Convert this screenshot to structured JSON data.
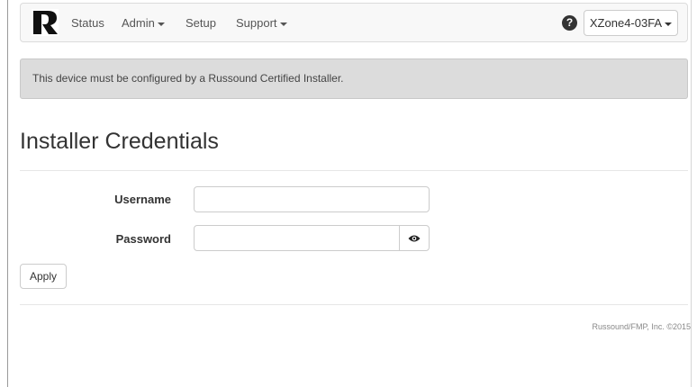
{
  "navbar": {
    "items": [
      {
        "label": "Status",
        "dropdown": false
      },
      {
        "label": "Admin",
        "dropdown": true
      },
      {
        "label": "Setup",
        "dropdown": false
      },
      {
        "label": "Support",
        "dropdown": true
      }
    ],
    "help_icon": "question-circle-icon",
    "device_label": "XZone4-03FA"
  },
  "alert": {
    "text": "This device must be configured by a Russound Certified Installer."
  },
  "page": {
    "title": "Installer Credentials"
  },
  "form": {
    "username_label": "Username",
    "username_value": "",
    "password_label": "Password",
    "password_value": "",
    "show_password_icon": "eye-icon",
    "apply_label": "Apply"
  },
  "footer": {
    "text": "Russound/FMP, Inc. ©2015"
  }
}
